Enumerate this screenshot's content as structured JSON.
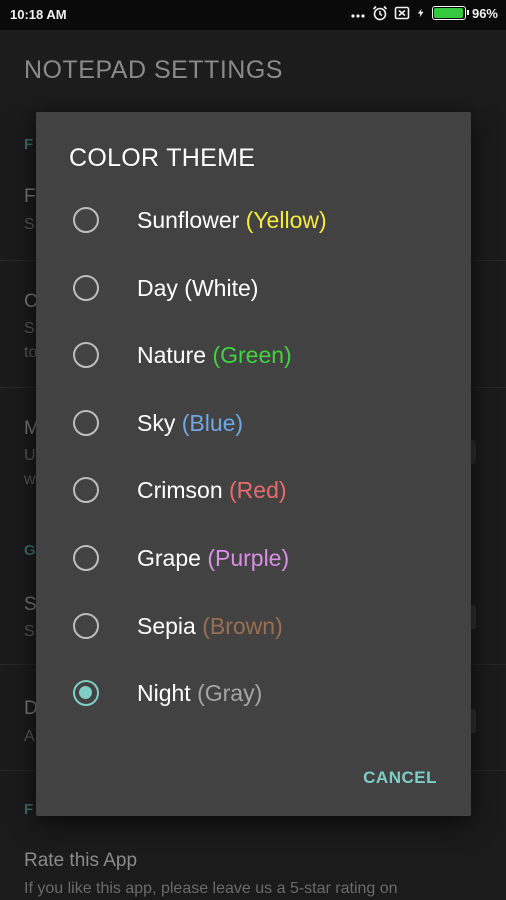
{
  "status_bar": {
    "time": "10:18 AM",
    "battery_percent": "96%",
    "battery_level": 0.96,
    "battery_color": "#35c93f",
    "icons": [
      "more-dots-icon",
      "alarm-icon",
      "notification-x-icon",
      "charging-bolt-icon",
      "battery-icon"
    ]
  },
  "app_bar": {
    "title": "NOTEPAD SETTINGS"
  },
  "background": {
    "header_1": "F",
    "item_1_title": "F",
    "item_1_sub": "S",
    "item_2_title": "C",
    "item_2_sub_line1": "S",
    "item_2_sub_line2": "to",
    "item_3_title": "M",
    "item_3_sub_line1": "U",
    "item_3_sub_line2": "w",
    "header_2": "G",
    "item_4_title": "S",
    "item_4_sub": "S",
    "item_5_title": "D",
    "item_5_sub": "A",
    "header_3": "F",
    "rate_title": "Rate this App",
    "rate_sub": "If you like this app, please leave us a 5-star rating on"
  },
  "dialog": {
    "title": "COLOR THEME",
    "cancel_label": "CANCEL",
    "accent_color": "#7fcdc4",
    "options": [
      {
        "name": "Sunflower",
        "color_label": "(Yellow)",
        "color": "#f5ec3b",
        "selected": false
      },
      {
        "name": "Day",
        "color_label": "(White)",
        "color": "#ffffff",
        "selected": false
      },
      {
        "name": "Nature",
        "color_label": "(Green)",
        "color": "#3fd33f",
        "selected": false
      },
      {
        "name": "Sky",
        "color_label": "(Blue)",
        "color": "#6fa7e3",
        "selected": false
      },
      {
        "name": "Crimson",
        "color_label": "(Red)",
        "color": "#e86b6b",
        "selected": false
      },
      {
        "name": "Grape",
        "color_label": "(Purple)",
        "color": "#da8fe6",
        "selected": false
      },
      {
        "name": "Sepia",
        "color_label": "(Brown)",
        "color": "#9a6e50",
        "selected": false
      },
      {
        "name": "Night",
        "color_label": "(Gray)",
        "color": "#a5a5a5",
        "selected": true
      }
    ]
  }
}
